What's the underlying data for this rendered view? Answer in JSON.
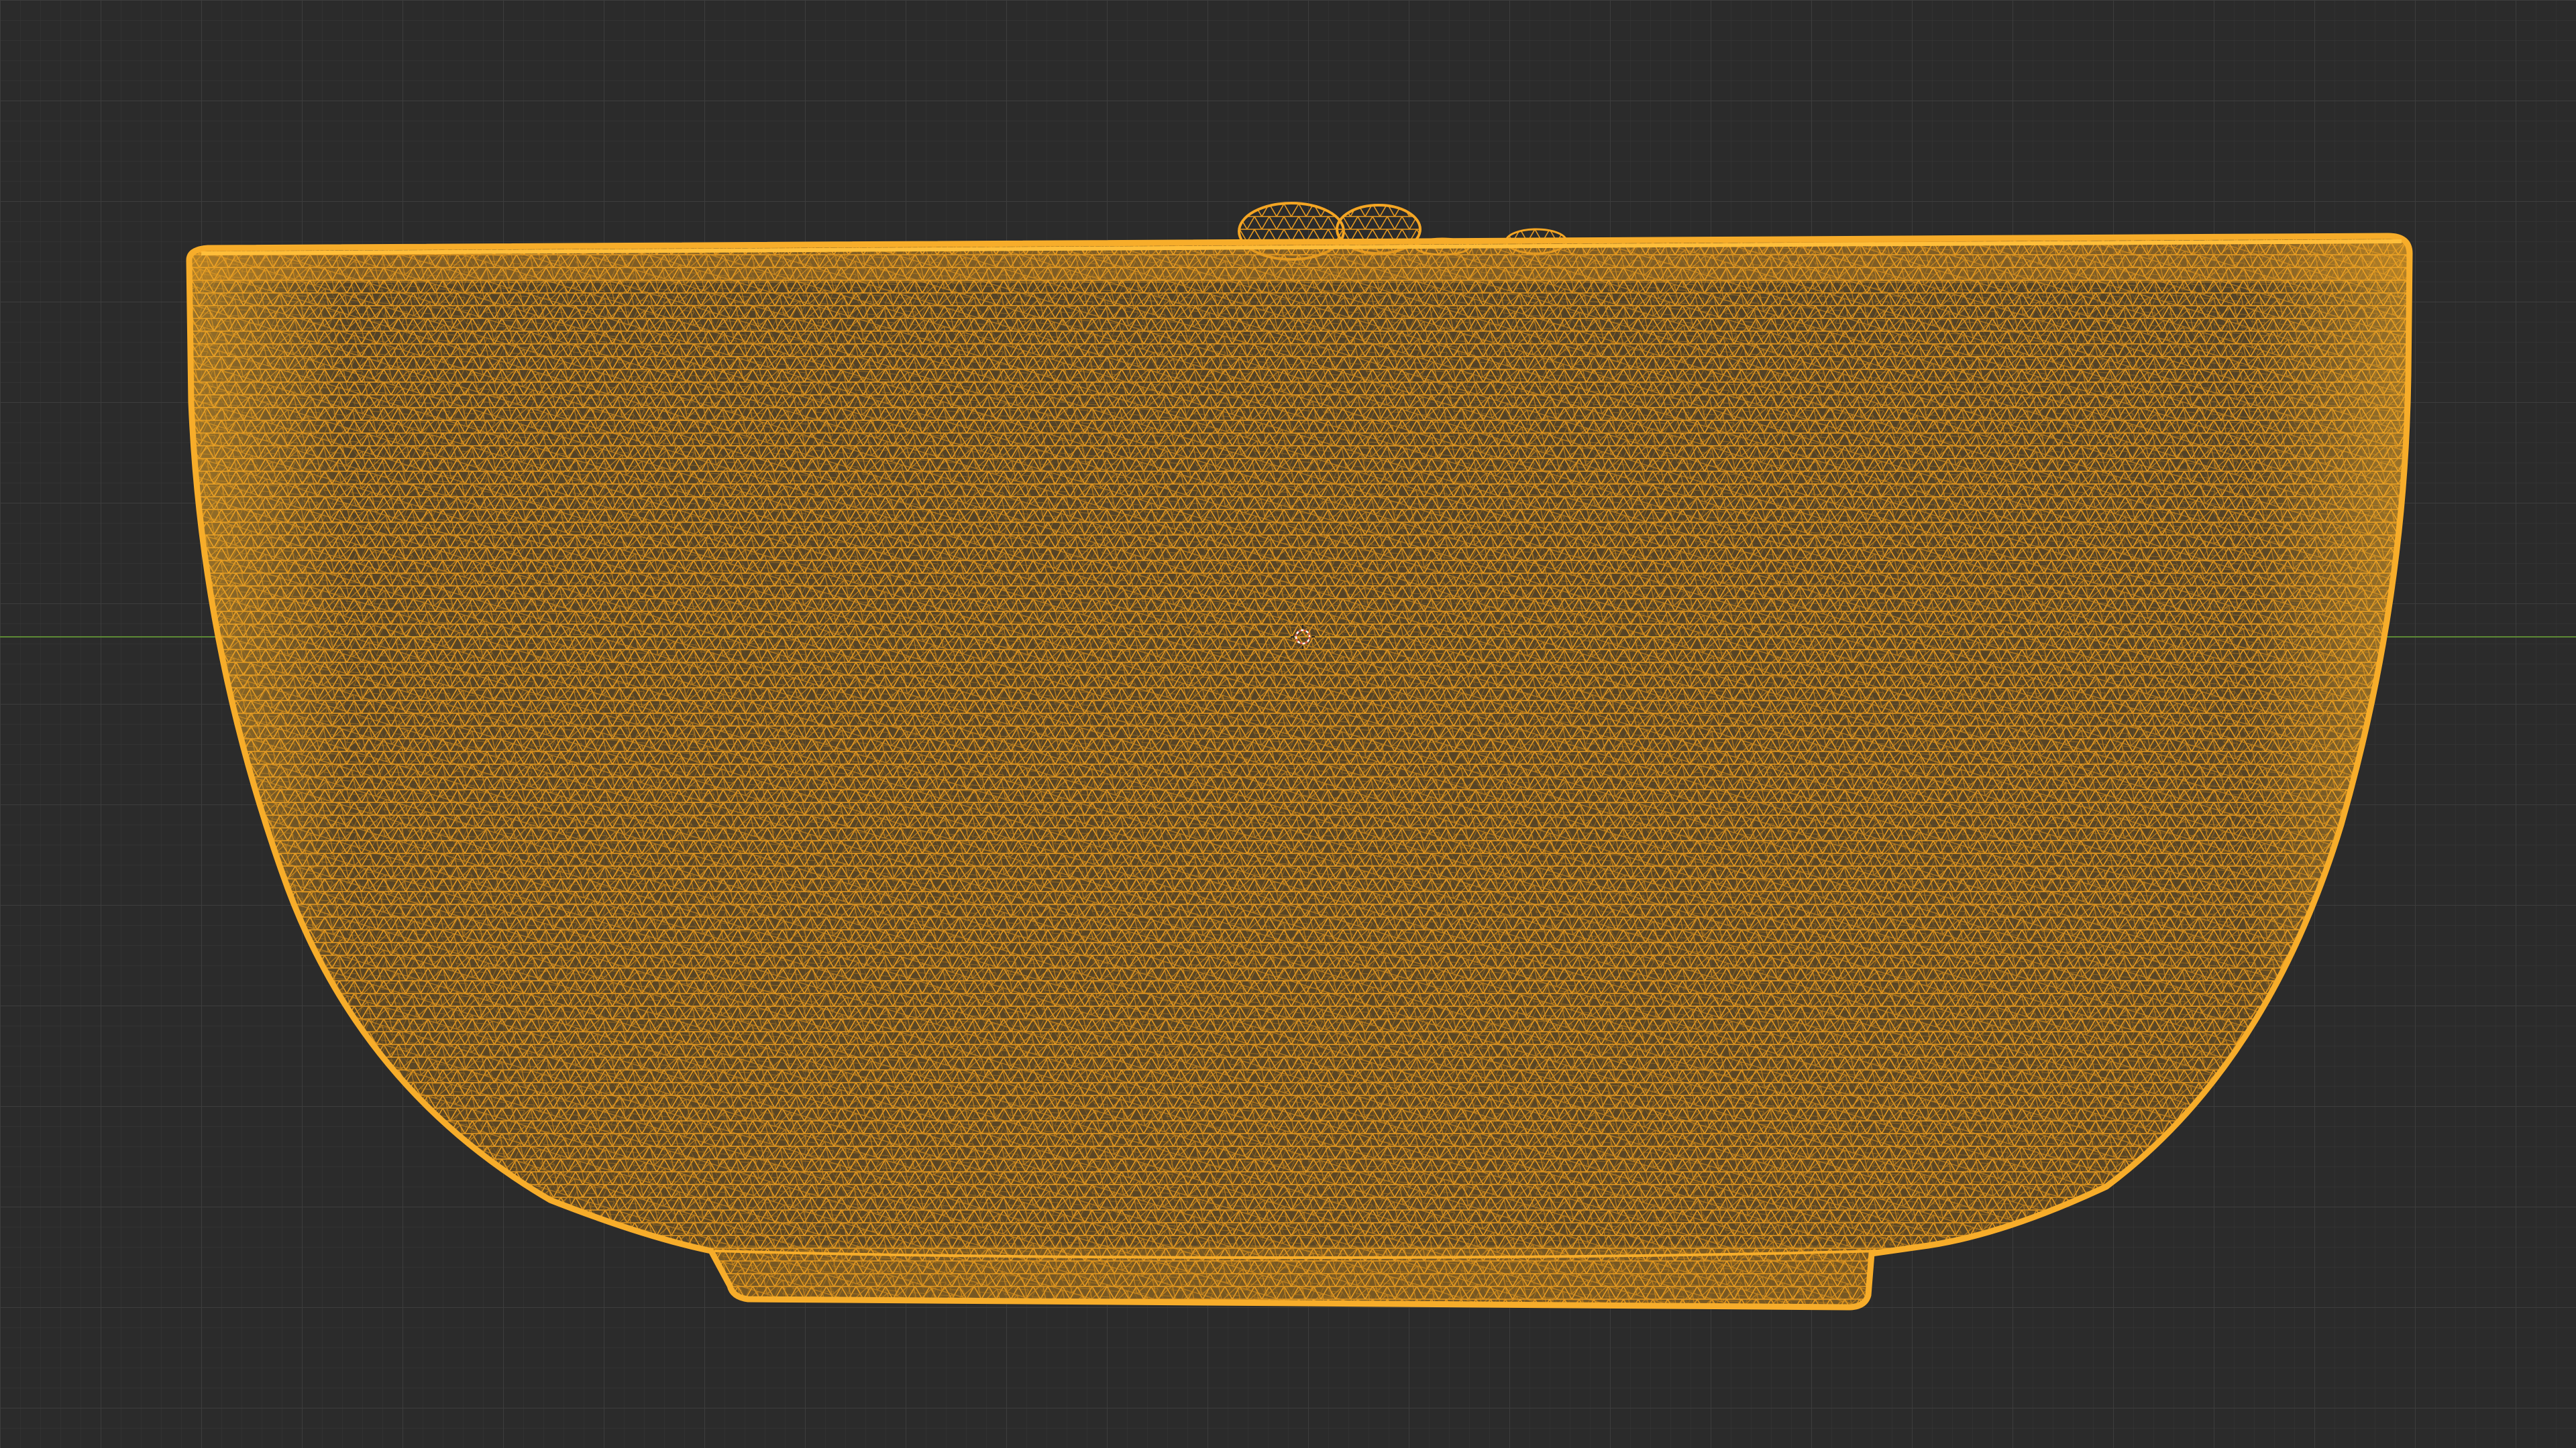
{
  "viewport": {
    "background_color": "#2b2b2b",
    "grid_minor_color": "#353535",
    "grid_major_color": "#3d3d3d",
    "x_axis_color": "#5d8a35",
    "shading_mode": "wireframe",
    "view": "front-orthographic"
  },
  "object": {
    "semantic": "bowl-mesh",
    "state": "selected-active",
    "wire_color": "#f5a623",
    "wire_dark_color": "#c98a1e",
    "topology": "triangulated-dense"
  },
  "cursor_3d": {
    "icon": "3d-cursor-icon",
    "ring_color_a": "#e05a4a",
    "ring_color_b": "#ffffff"
  }
}
